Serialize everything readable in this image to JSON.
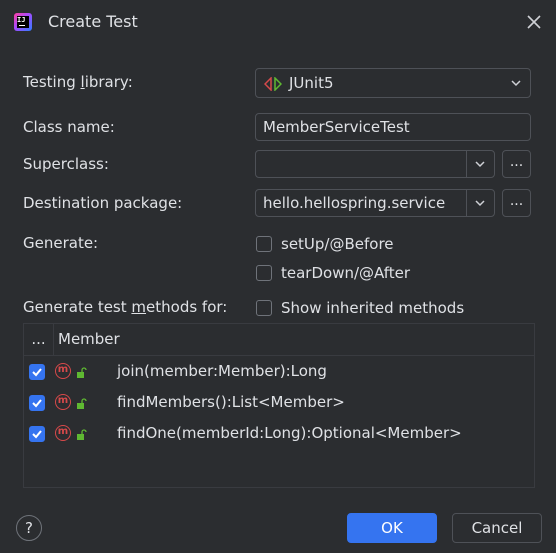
{
  "window": {
    "title": "Create Test"
  },
  "form": {
    "testing_library": {
      "label_pre": "Testing ",
      "label_mnemonic": "l",
      "label_post": "ibrary:",
      "value": "JUnit5"
    },
    "class_name": {
      "label": "Class name:",
      "value": "MemberServiceTest"
    },
    "superclass": {
      "label": "Superclass:",
      "value": "",
      "browse_label": "..."
    },
    "destination_package": {
      "label": "Destination package:",
      "value": "hello.hellospring.service",
      "browse_label": "..."
    },
    "generate": {
      "label": "Generate:",
      "setup_label": "setUp/@Before",
      "setup_checked": false,
      "teardown_label": "tearDown/@After",
      "teardown_checked": false
    },
    "methods_for": {
      "label_pre": "Generate test ",
      "label_mnemonic": "m",
      "label_post": "ethods for:",
      "show_inherited_label": "Show inherited methods",
      "show_inherited_checked": false
    }
  },
  "table": {
    "header_dots": "...",
    "header_member": "Member",
    "rows": [
      {
        "checked": true,
        "text": "join(member:Member):Long"
      },
      {
        "checked": true,
        "text": "findMembers():List<Member>"
      },
      {
        "checked": true,
        "text": "findOne(memberId:Long):Optional<Member>"
      }
    ]
  },
  "footer": {
    "help": "?",
    "ok_label": "OK",
    "cancel_label": "Cancel"
  },
  "colors": {
    "accent": "#3574f0",
    "background": "#2b2d30",
    "method_icon": "#d6494a",
    "lock_icon": "#5fb832"
  },
  "icons": [
    "intellij-app-icon",
    "close-icon",
    "junit-icon",
    "chevron-down-icon",
    "method-icon",
    "lock-icon",
    "help-icon"
  ]
}
